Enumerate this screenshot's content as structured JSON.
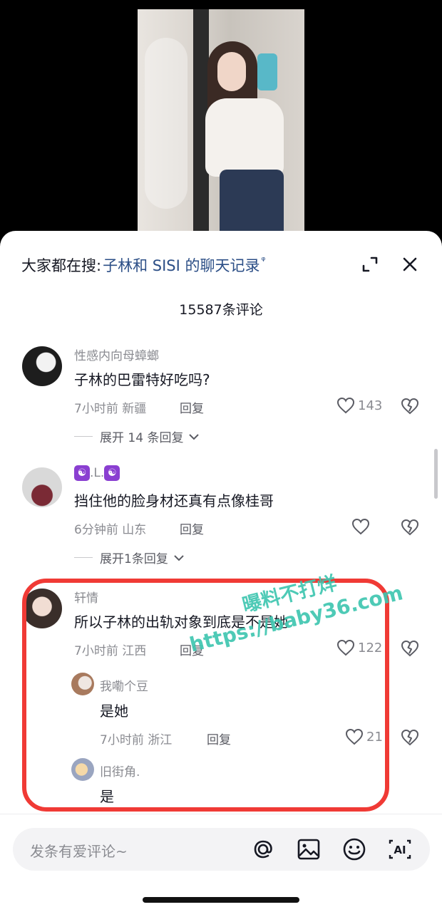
{
  "search": {
    "prefix": "大家都在搜:",
    "term": "子林和 SISI 的聊天记录",
    "glyph": "ᵠ"
  },
  "comments_count": "15587条评论",
  "comments": [
    {
      "username": "性感内向母蟑螂",
      "text": "子林的巴雷特好吃吗?",
      "time_location": "7小时前 新疆",
      "reply_label": "回复",
      "likes": "143",
      "expand_label": "展开 14 条回复"
    },
    {
      "username": ".L.",
      "username_badge": "☯",
      "text": "挡住他的脸身材还真有点像桂哥",
      "time_location": "6分钟前 山东",
      "reply_label": "回复",
      "likes": "",
      "expand_label": "展开1条回复"
    },
    {
      "username": "轩情",
      "text": "所以子林的出轨对象到底是不是她",
      "time_location": "7小时前 江西",
      "reply_label": "回复",
      "likes": "122",
      "replies": [
        {
          "username": "我嘞个豆",
          "text": "是她",
          "time_location": "7小时前 浙江",
          "reply_label": "回复",
          "likes": "21"
        },
        {
          "username": "旧街角.",
          "text": "是"
        }
      ]
    }
  ],
  "watermark": {
    "line1": "曝料不打烊",
    "line2": "https://baby36.com"
  },
  "input": {
    "placeholder": "发条有爱评论~",
    "ai_label": "AI"
  },
  "colors": {
    "link": "#2b4e86",
    "highlight_box": "#f03a35",
    "watermark": "#3fc6b0",
    "muted": "#8a8b91"
  }
}
